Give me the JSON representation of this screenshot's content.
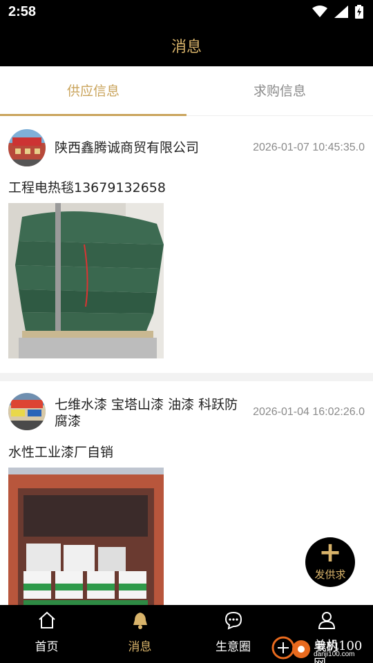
{
  "status_bar": {
    "time": "2:58"
  },
  "header": {
    "title": "消息"
  },
  "tabs": [
    {
      "label": "供应信息",
      "active": true
    },
    {
      "label": "求购信息",
      "active": false
    }
  ],
  "posts": [
    {
      "company": "陕西鑫腾诚商贸有限公司",
      "timestamp": "2026-01-07 10:45:35.0",
      "text": "工程电热毯13679132658"
    },
    {
      "company": "七维水漆 宝塔山漆 油漆  科跃防腐漆",
      "timestamp": "2026-01-04 16:02:26.0",
      "text": "水性工业漆厂自销"
    }
  ],
  "fab": {
    "plus": "+",
    "label": "发供求"
  },
  "bottom_nav": [
    {
      "label": "首页",
      "icon": "home-icon",
      "active": false
    },
    {
      "label": "消息",
      "icon": "bell-icon",
      "active": true
    },
    {
      "label": "生意圈",
      "icon": "chat-icon",
      "active": false
    },
    {
      "label": "我的",
      "icon": "user-icon",
      "active": false
    }
  ],
  "watermark": {
    "text": "单机100网",
    "url": "danji100.com"
  },
  "colors": {
    "accent": "#c9a35a",
    "header_bg": "#000000",
    "title_gold": "#d8b36a"
  }
}
